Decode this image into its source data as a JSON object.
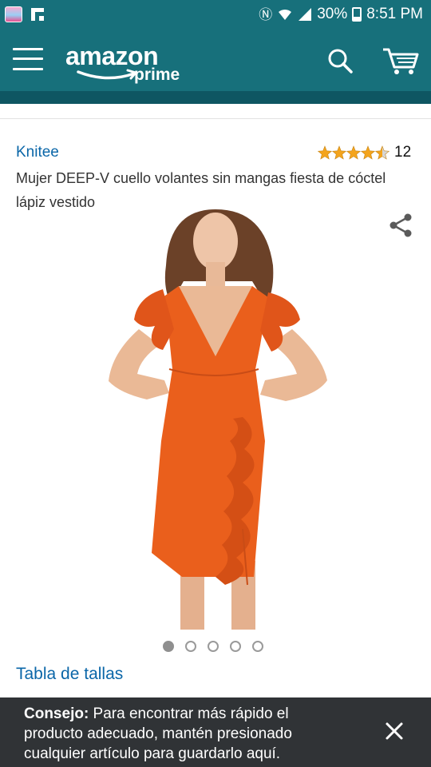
{
  "status_bar": {
    "battery": "30%",
    "time": "8:51 PM",
    "icons": [
      "photo-app-icon",
      "flipboard-icon",
      "nfc-icon",
      "wifi-icon",
      "signal-icon",
      "battery-icon"
    ]
  },
  "header": {
    "logo_word": "amazon",
    "logo_sub": "prime",
    "icons": [
      "menu-icon",
      "search-icon",
      "cart-icon"
    ]
  },
  "product": {
    "brand": "Knitee",
    "rating_stars": 4.5,
    "review_count": "12",
    "title": "Mujer DEEP-V cuello volantes sin mangas fiesta de cóctel lápiz vestido",
    "image_count": 5,
    "active_image": 1,
    "size_chart_link": "Tabla de tallas"
  },
  "tip": {
    "label": "Consejo:",
    "text": " Para encontrar más rápido el producto adecuado, mantén presionado cualquier artículo para guardarlo aquí."
  },
  "colors": {
    "header": "#17707b",
    "link": "#0a66a8",
    "star": "#f4a41c",
    "dress": "#ea5f1c",
    "tip_bg": "#303336"
  }
}
